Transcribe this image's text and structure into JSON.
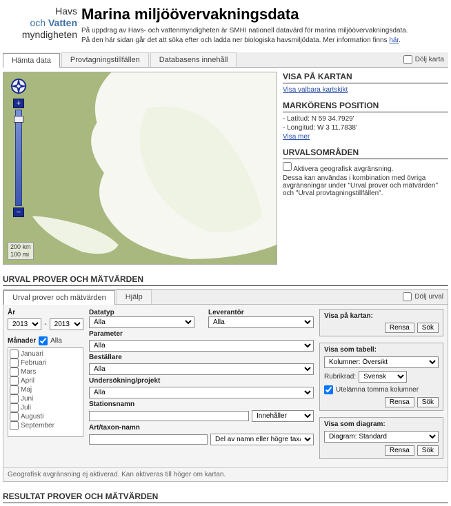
{
  "logo": {
    "l1a": "Havs",
    "l2a": "och",
    "l2b": "Vatten",
    "l3": "myndigheten"
  },
  "title": "Marina miljöövervakningsdata",
  "intro1": "På uppdrag av Havs- och vattenmyndigheten är SMHI nationell datavärd för marina miljöövervakningsdata.",
  "intro2a": "På den här sidan går det att söka efter och ladda ner biologiska havsmiljödata. Mer information finns ",
  "intro2_link": "här",
  "tabs": {
    "t1": "Hämta data",
    "t2": "Provtagningstillfällen",
    "t3": "Databasens innehåll",
    "hide_map": "Dölj karta"
  },
  "map": {
    "scale_km": "200 km",
    "scale_mi": "100 mi"
  },
  "side": {
    "h1": "VISA PÅ KARTAN",
    "link1": "Visa valbara kartskikt",
    "h2": "MARKÖRENS POSITION",
    "lat": "- Latitud: N 59 34.7929'",
    "lon": "- Longitud: W 3 11.7838'",
    "more": "Visa mer",
    "h3": "URVALSOMRÅDEN",
    "chk": "Aktivera geografisk avgränsning.",
    "desc": "Dessa kan användas i kombination med övriga avgränsningar under \"Urval prover och mätvärden\" och \"Urval provtagningstillfällen\"."
  },
  "sec1": "URVAL PROVER OCH MÄTVÄRDEN",
  "filter_tabs": {
    "t1": "Urval prover och mätvärden",
    "t2": "Hjälp",
    "hide": "Dölj urval"
  },
  "f": {
    "year": "År",
    "year_from": "2013",
    "year_to": "2013",
    "months_label": "Månader",
    "all": "Alla",
    "months": [
      "Januari",
      "Februari",
      "Mars",
      "April",
      "Maj",
      "Juni",
      "Juli",
      "Augusti",
      "September"
    ],
    "datatype": "Datatyp",
    "alla": "Alla",
    "leverantor": "Leverantör",
    "parameter": "Parameter",
    "bestallare": "Beställare",
    "undersokning": "Undersökning/projekt",
    "stationsnamn": "Stationsnamn",
    "innehaller": "Innehåller",
    "art": "Art/taxon-namn",
    "del_av": "Del av namn eller högre taxa"
  },
  "right": {
    "h1": "Visa på kartan:",
    "rensa": "Rensa",
    "sok": "Sök",
    "h2": "Visa som tabell:",
    "kolumner": "Kolumner: Översikt",
    "rubrik": "Rubrikrad:",
    "svensk": "Svensk",
    "utel": "Utelämna tomma kolumner",
    "h3": "Visa som diagram:",
    "diagram": "Diagram: Standard"
  },
  "note": "Geografisk avgränsning ej aktiverad. Kan aktiveras till höger om kartan.",
  "sec2": "RESULTAT PROVER OCH MÄTVÄRDEN"
}
